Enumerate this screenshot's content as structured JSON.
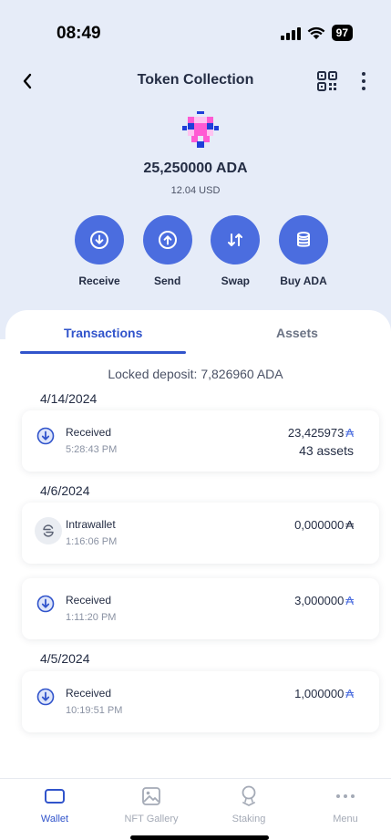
{
  "status_bar": {
    "time": "08:49",
    "battery": "97"
  },
  "header": {
    "title": "Token Collection"
  },
  "token": {
    "balance": "25,250000 ADA",
    "fiat": "12.04 USD"
  },
  "actions": [
    {
      "label": "Receive",
      "icon": "arrow-down-circle-icon"
    },
    {
      "label": "Send",
      "icon": "arrow-up-circle-icon"
    },
    {
      "label": "Swap",
      "icon": "swap-icon"
    },
    {
      "label": "Buy ADA",
      "icon": "database-icon"
    }
  ],
  "tabs": [
    {
      "label": "Transactions",
      "active": true
    },
    {
      "label": "Assets",
      "active": false
    }
  ],
  "locked_deposit": "Locked deposit: 7,826960 ADA",
  "groups": [
    {
      "date": "4/14/2024",
      "transactions": [
        {
          "type": "Received",
          "time": "5:28:43 PM",
          "amount": "23,425973",
          "currency": "₳",
          "assets": "43 assets"
        }
      ]
    },
    {
      "date": "4/6/2024",
      "transactions": [
        {
          "type": "Intrawallet",
          "time": "1:16:06 PM",
          "amount": "0,000000",
          "currency": "₳"
        },
        {
          "type": "Received",
          "time": "1:11:20 PM",
          "amount": "3,000000",
          "currency": "₳"
        }
      ]
    },
    {
      "date": "4/5/2024",
      "transactions": [
        {
          "type": "Received",
          "time": "10:19:51 PM",
          "amount": "1,000000",
          "currency": "₳"
        }
      ]
    }
  ],
  "bottom_nav": [
    {
      "label": "Wallet",
      "icon": "wallet-icon",
      "active": true
    },
    {
      "label": "NFT Gallery",
      "icon": "image-icon",
      "active": false
    },
    {
      "label": "Staking",
      "icon": "staking-icon",
      "active": false
    },
    {
      "label": "Menu",
      "icon": "menu-dots-icon",
      "active": false
    }
  ],
  "colors": {
    "accent": "#4b6ddf",
    "active_tab": "#3154cb",
    "header_bg": "#e6ecf8",
    "text": "#242d44"
  }
}
